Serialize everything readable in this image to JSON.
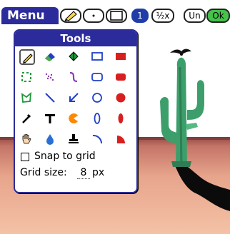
{
  "menu_label": "Menu",
  "toolbar": {
    "buttons": [
      {
        "name": "pencil-tool-button",
        "label": "",
        "icon": "pencil-icon"
      },
      {
        "name": "dot-tool-button",
        "label": "",
        "icon": "dot-icon"
      },
      {
        "name": "rectangle-tool-button",
        "label": "",
        "icon": "rectangle-icon"
      },
      {
        "name": "layer-1-button",
        "label": "1",
        "selected": true
      },
      {
        "name": "half-zoom-button",
        "label": "½x"
      },
      {
        "name": "undo-button",
        "label": "Un"
      },
      {
        "name": "ok-button",
        "label": "Ok"
      }
    ]
  },
  "tools_panel": {
    "title": "Tools",
    "snap_to_grid": {
      "label": "Snap to grid",
      "checked": false
    },
    "grid_size": {
      "label": "Grid size:",
      "value": "8",
      "unit": "px"
    },
    "tools": [
      "pencil-icon",
      "eraser-icon",
      "fill-bucket-icon",
      "rectangle-outline-icon",
      "rectangle-filled-icon",
      "marquee-select-icon",
      "spray-icon",
      "curve-icon",
      "rounded-rect-outline-icon",
      "rounded-rect-filled-icon",
      "lasso-icon",
      "line-icon",
      "arrow-icon",
      "circle-outline-icon",
      "circle-filled-icon",
      "eyedropper-icon",
      "text-tool-icon",
      "pie-icon",
      "ellipse-outline-icon",
      "ellipse-filled-icon",
      "hand-pan-icon",
      "water-drop-icon",
      "stamp-icon",
      "arc-icon",
      "quarter-pie-icon"
    ]
  },
  "colors": {
    "title_bar": "#2b2b9b",
    "toolbar_selected": "#1f3ca8",
    "ok_button": "#44c24a",
    "tool_green": "#1f9a3a",
    "tool_blue": "#2040c8",
    "tool_purple": "#8e3ab0",
    "tool_red": "#d81f1f",
    "tool_orange": "#ff8800",
    "sky_top": "#ffffff",
    "horizon": "#c97b69",
    "ground": "#efb59c",
    "cactus": "#3c9f6b"
  }
}
